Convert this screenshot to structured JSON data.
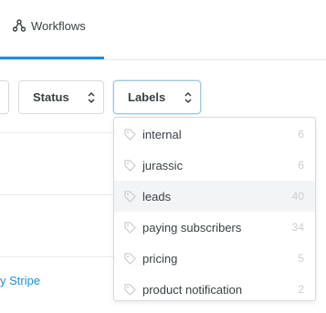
{
  "header": {
    "tab_label": "Workflows",
    "accent_color": "#1f8fd6",
    "tab_icon": "workflow-icon"
  },
  "filters": {
    "status_label": "Status",
    "labels_label": "Labels",
    "arrow_icon": "sort-arrows-icon"
  },
  "background": {
    "link_text": "y Stripe"
  },
  "labels_dropdown": {
    "item_icon": "tag-icon",
    "items": [
      {
        "name": "internal",
        "count": "6"
      },
      {
        "name": "jurassic",
        "count": "6"
      },
      {
        "name": "leads",
        "count": "40"
      },
      {
        "name": "paying subscribers",
        "count": "34"
      },
      {
        "name": "pricing",
        "count": "5"
      },
      {
        "name": "product notification",
        "count": "2"
      }
    ]
  }
}
